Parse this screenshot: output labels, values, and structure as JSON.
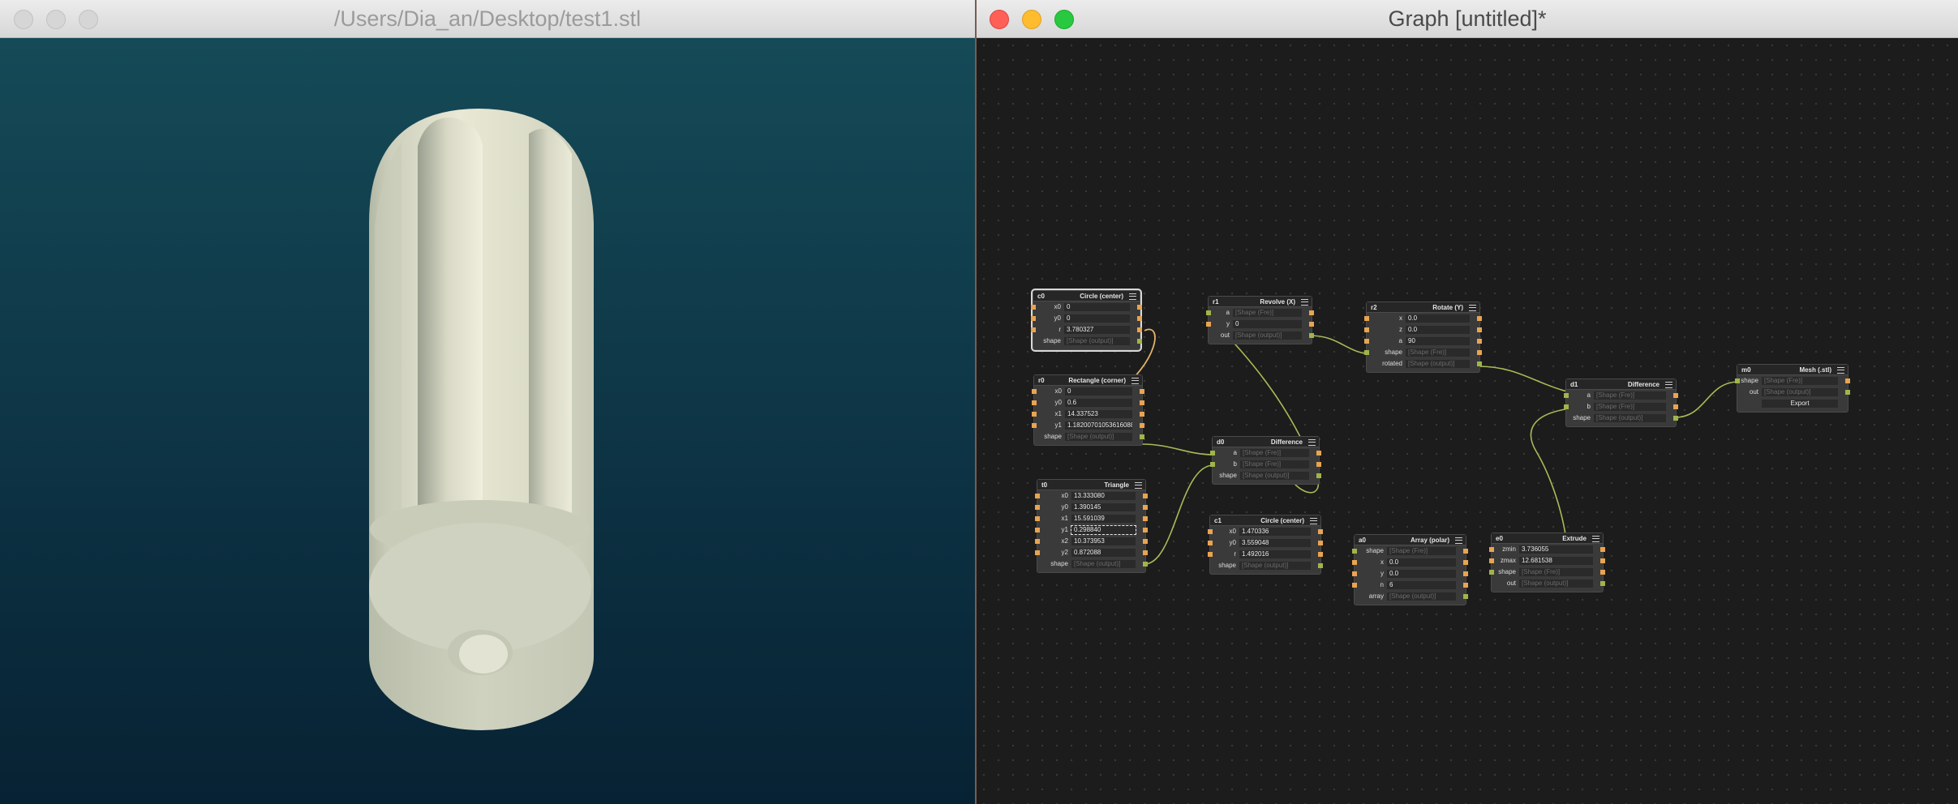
{
  "viewer": {
    "title": "/Users/Dia_an/Desktop/test1.stl"
  },
  "graph": {
    "title": "Graph [untitled]*",
    "nodes": {
      "c0": {
        "id": "c0",
        "title": "Circle (center)",
        "rows": [
          {
            "l": "x0",
            "v": "0"
          },
          {
            "l": "y0",
            "v": "0"
          },
          {
            "l": "r",
            "v": "3.780327"
          },
          {
            "l": "shape",
            "v": "[Shape (output)]"
          }
        ]
      },
      "r1": {
        "id": "r1",
        "title": "Revolve (X)",
        "rows": [
          {
            "l": "a",
            "v": "[Shape (Fre)]"
          },
          {
            "l": "y",
            "v": "0"
          },
          {
            "l": "out",
            "v": "[Shape (output)]"
          }
        ]
      },
      "r2": {
        "id": "r2",
        "title": "Rotate (Y)",
        "rows": [
          {
            "l": "x",
            "v": "0.0"
          },
          {
            "l": "z",
            "v": "0.0"
          },
          {
            "l": "a",
            "v": "90"
          },
          {
            "l": "shape",
            "v": "[Shape (Fre)]"
          },
          {
            "l": "rotated",
            "v": "[Shape (output)]"
          }
        ]
      },
      "r0": {
        "id": "r0",
        "title": "Rectangle (corner)",
        "rows": [
          {
            "l": "x0",
            "v": "0"
          },
          {
            "l": "y0",
            "v": "0.6"
          },
          {
            "l": "x1",
            "v": "14.337523"
          },
          {
            "l": "y1",
            "v": "1.18200701053616088"
          },
          {
            "l": "shape",
            "v": "[Shape (output)]"
          }
        ]
      },
      "d0": {
        "id": "d0",
        "title": "Difference",
        "rows": [
          {
            "l": "a",
            "v": "[Shape (Fre)]"
          },
          {
            "l": "b",
            "v": "[Shape (Fre)]"
          },
          {
            "l": "shape",
            "v": "[Shape (output)]"
          }
        ]
      },
      "d1": {
        "id": "d1",
        "title": "Difference",
        "rows": [
          {
            "l": "a",
            "v": "[Shape (Fre)]"
          },
          {
            "l": "b",
            "v": "[Shape (Fre)]"
          },
          {
            "l": "shape",
            "v": "[Shape (output)]"
          }
        ]
      },
      "m0": {
        "id": "m0",
        "title": "Mesh (.stl)",
        "rows": [
          {
            "l": "shape",
            "v": "[Shape (Fre)]"
          },
          {
            "l": "out",
            "v": "[Shape (output)]"
          }
        ],
        "export": "Export"
      },
      "t0": {
        "id": "t0",
        "title": "Triangle",
        "rows": [
          {
            "l": "x0",
            "v": "13.333080"
          },
          {
            "l": "y0",
            "v": "1.390145"
          },
          {
            "l": "x1",
            "v": "15.591039"
          },
          {
            "l": "y1",
            "v": "0.298840"
          },
          {
            "l": "x2",
            "v": "10.373953"
          },
          {
            "l": "y2",
            "v": "0.872088"
          },
          {
            "l": "shape",
            "v": "[Shape (output)]"
          }
        ]
      },
      "c1": {
        "id": "c1",
        "title": "Circle (center)",
        "rows": [
          {
            "l": "x0",
            "v": "1.470336"
          },
          {
            "l": "y0",
            "v": "3.559048"
          },
          {
            "l": "r",
            "v": "1.492016"
          },
          {
            "l": "shape",
            "v": "[Shape (output)]"
          }
        ]
      },
      "a0": {
        "id": "a0",
        "title": "Array (polar)",
        "rows": [
          {
            "l": "shape",
            "v": "[Shape (Fre)]"
          },
          {
            "l": "x",
            "v": "0.0"
          },
          {
            "l": "y",
            "v": "0.0"
          },
          {
            "l": "n",
            "v": "6"
          },
          {
            "l": "array",
            "v": "[Shape (output)]"
          }
        ]
      },
      "e0": {
        "id": "e0",
        "title": "Extrude",
        "rows": [
          {
            "l": "zmin",
            "v": "3.736055"
          },
          {
            "l": "zmax",
            "v": "12.681538"
          },
          {
            "l": "shape",
            "v": "[Shape (Fre)]"
          },
          {
            "l": "out",
            "v": "[Shape (output)]"
          }
        ]
      }
    }
  },
  "colors": {
    "wire": "#a7bb57",
    "wire_selected": "#e4b46a",
    "port_number": "#e8a451",
    "port_shape": "#9fb54a"
  }
}
